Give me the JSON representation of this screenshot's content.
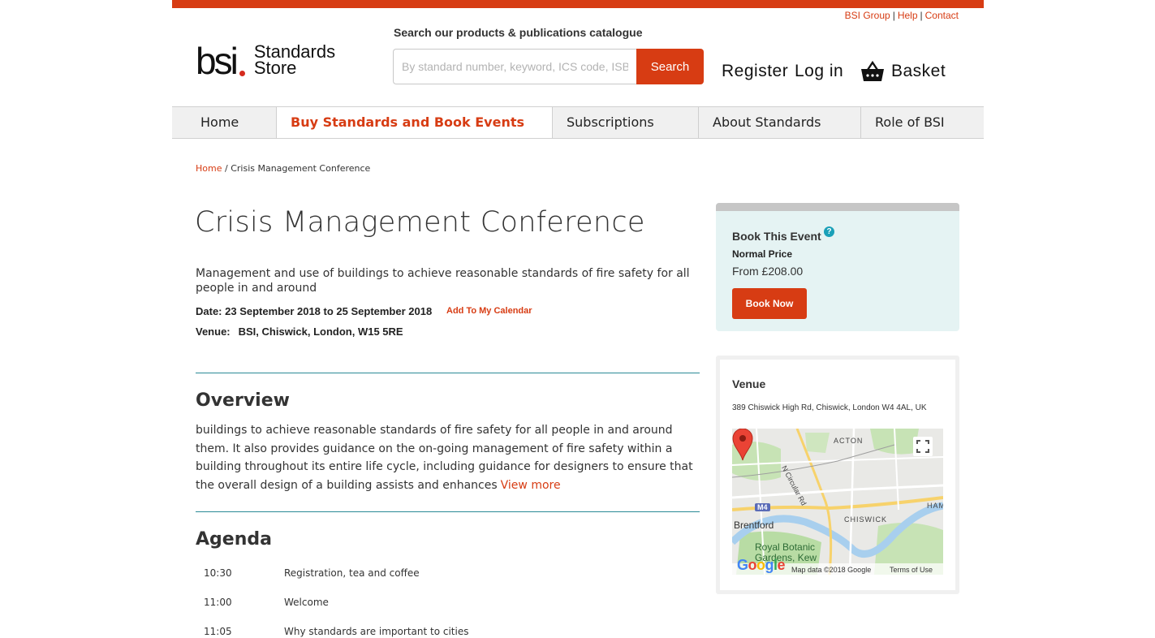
{
  "header": {
    "util_links": [
      "BSI Group",
      "Help",
      "Contact"
    ],
    "logo_text": "bsi",
    "logo_store_line1": "Standards",
    "logo_store_line2": "Store",
    "search_caption": "Search our products & publications catalogue",
    "search_placeholder": "By standard number, keyword, ICS code, ISBN",
    "search_button": "Search",
    "register": "Register",
    "login": "Log in",
    "basket": "Basket"
  },
  "nav": {
    "items": [
      "Home",
      "Buy Standards and Book Events",
      "Subscriptions",
      "About Standards",
      "Role of BSI"
    ],
    "active_index": 1
  },
  "breadcrumb": {
    "home": "Home",
    "separator": "/",
    "current": "Crisis Management Conference"
  },
  "event": {
    "title": "Crisis Management Conference",
    "summary": "Management and use of buildings to achieve reasonable standards of fire safety for all people in and around",
    "date_line": "Date: 23 September 2018 to 25 September 2018",
    "calendar_link": "Add To My Calendar",
    "venue_label": "Venue:",
    "venue_value": "BSI, Chiswick, London, W15 5RE"
  },
  "overview": {
    "heading": "Overview",
    "text": "buildings to achieve reasonable standards of fire safety for all people in and around them. It also provides guidance on the on-going management of fire safety within a building throughout its entire life cycle, including guidance for designers to ensure that the overall design of a building assists and enhances",
    "more_link": "View more"
  },
  "agenda": {
    "heading": "Agenda",
    "rows": [
      {
        "time": "10:30",
        "desc": "Registration, tea and coffee"
      },
      {
        "time": "11:00",
        "desc": "Welcome"
      },
      {
        "time": "11:05",
        "desc": "Why standards are important to cities"
      }
    ]
  },
  "booking": {
    "title": "Book This Event",
    "help_glyph": "?",
    "price_label": "Normal Price",
    "price": "From £208.00",
    "button": "Book Now"
  },
  "venue_card": {
    "title": "Venue",
    "address": "389 Chiswick High Rd, Chiswick, London W4 4AL, UK",
    "map": {
      "labels": {
        "acton": "ACTON",
        "chiswick": "CHISWICK",
        "brentford": "Brentford",
        "kew": "Royal Botanic Gardens, Kew",
        "ham": "HAM",
        "road": "N Circular Rd",
        "motorway": "M4"
      },
      "attribution": "Map data ©2018 Google",
      "terms": "Terms of Use",
      "google": "Google"
    }
  },
  "colors": {
    "brand": "#d73c13",
    "accent_teal": "#2a8a96",
    "booking_bg": "#e5f3f3"
  },
  "icons": [
    "basket-icon",
    "help-icon",
    "map-pin-icon",
    "fullscreen-icon"
  ]
}
